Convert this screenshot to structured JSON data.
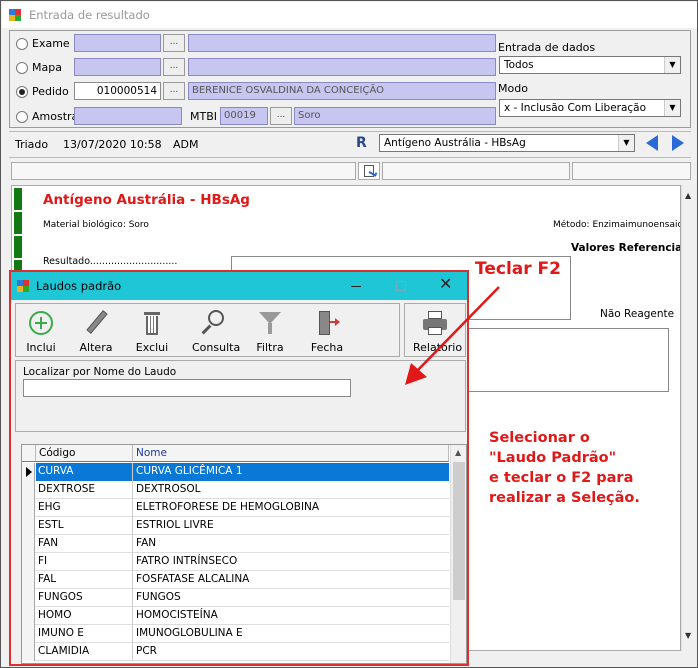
{
  "window": {
    "title": "Entrada de resultado"
  },
  "form": {
    "exame_label": "Exame",
    "mapa_label": "Mapa",
    "pedido_label": "Pedido",
    "amostra_label": "Amostra",
    "pedido_value": "010000514",
    "patient_name": "BERENICE OSVALDINA DA CONCEIÇÃO",
    "mtbi_label": "MTBI",
    "mtbi_value": "00019",
    "material_value": "Soro",
    "entrada_label": "Entrada de dados",
    "entrada_value": "Todos",
    "modo_label": "Modo",
    "modo_value": "x - Inclusão Com Liberação"
  },
  "statusbar": {
    "status": "Triado",
    "datetime": "13/07/2020 10:58",
    "user": "ADM",
    "r_badge": "R",
    "exam_value": "Antígeno Austrália - HBsAg"
  },
  "report": {
    "title": "Antígeno Austrália - HBsAg",
    "material": "Material biológico: Soro",
    "metodo": "Método: Enzimaimunoensaio",
    "valores": "Valores Referenciais",
    "resultado": "Resultado.............................",
    "nao_reagente": "Não Reagente"
  },
  "dialog": {
    "title": "Laudos padrão",
    "toolbar": {
      "inclui": "Inclui",
      "altera": "Altera",
      "exclui": "Exclui",
      "consulta": "Consulta",
      "filtra": "Filtra",
      "fecha": "Fecha",
      "relatorio": "Relatório"
    },
    "search_label": "Localizar por Nome do Laudo",
    "search_value": "",
    "columns": {
      "codigo": "Código",
      "nome": "Nome"
    },
    "rows": [
      {
        "codigo": "CURVA",
        "nome": "CURVA GLICÊMICA 1",
        "selected": true
      },
      {
        "codigo": "DEXTROSE",
        "nome": "DEXTROSOL"
      },
      {
        "codigo": "EHG",
        "nome": "ELETROFORESE DE HEMOGLOBINA"
      },
      {
        "codigo": "ESTL",
        "nome": "ESTRIOL LIVRE"
      },
      {
        "codigo": "FAN",
        "nome": "FAN"
      },
      {
        "codigo": "FI",
        "nome": "FATRO INTRÍNSECO"
      },
      {
        "codigo": "FAL",
        "nome": "FOSFATASE ALCALINA"
      },
      {
        "codigo": "FUNGOS",
        "nome": "FUNGOS"
      },
      {
        "codigo": "HOMO",
        "nome": "HOMOCISTEÍNA"
      },
      {
        "codigo": "IMUNO E",
        "nome": "IMUNOGLOBULINA E"
      },
      {
        "codigo": "CLAMIDIA",
        "nome": "PCR"
      }
    ]
  },
  "annotations": {
    "f2": "Teclar F2",
    "instr_1": "Selecionar o",
    "instr_2": "\"Laudo Padrão\"",
    "instr_3": "e teclar o F2 para",
    "instr_4": "realizar a Seleção."
  },
  "colors": {
    "accent_red": "#e01818",
    "dialog_title": "#1fc7d6",
    "selection": "#0a78d7",
    "field": "#c6c6f0"
  }
}
